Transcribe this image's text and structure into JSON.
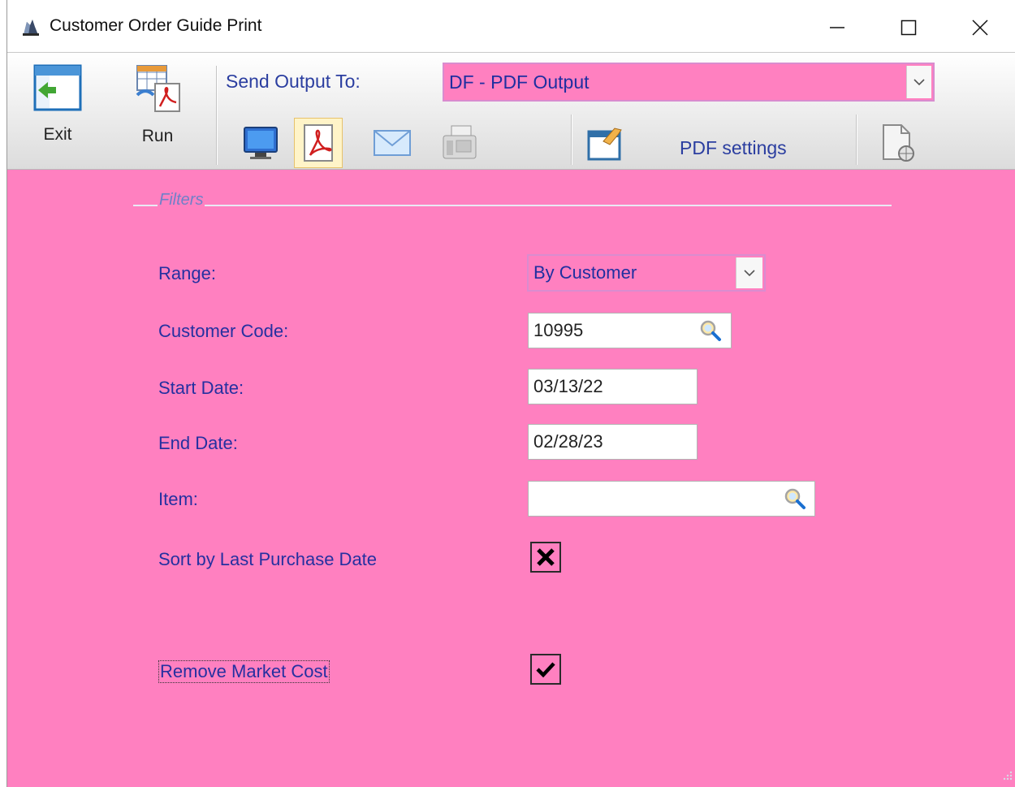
{
  "window": {
    "title": "Customer Order Guide Print"
  },
  "toolbar": {
    "exit_label": "Exit",
    "run_label": "Run",
    "send_output_label": "Send Output To:",
    "output_selected": "DF - PDF Output",
    "pdf_settings_label": "PDF settings",
    "output_icons": [
      "screen-icon",
      "pdf-icon",
      "email-icon",
      "fax-icon"
    ],
    "active_output": "pdf-icon"
  },
  "filters": {
    "legend": "Filters",
    "range_label": "Range:",
    "range_value": "By Customer",
    "customer_code_label": "Customer Code:",
    "customer_code_value": "10995",
    "start_date_label": "Start Date:",
    "start_date_value": "03/13/22",
    "end_date_label": "End Date:",
    "end_date_value": "02/28/23",
    "item_label": "Item:",
    "item_value": "",
    "sort_label": "Sort by Last Purchase Date",
    "sort_checked": "x-mark",
    "remove_label": "Remove Market Cost",
    "remove_checked": "checkmark"
  },
  "colors": {
    "accent_bg": "#ff80c0",
    "label_text": "#2530a0"
  }
}
